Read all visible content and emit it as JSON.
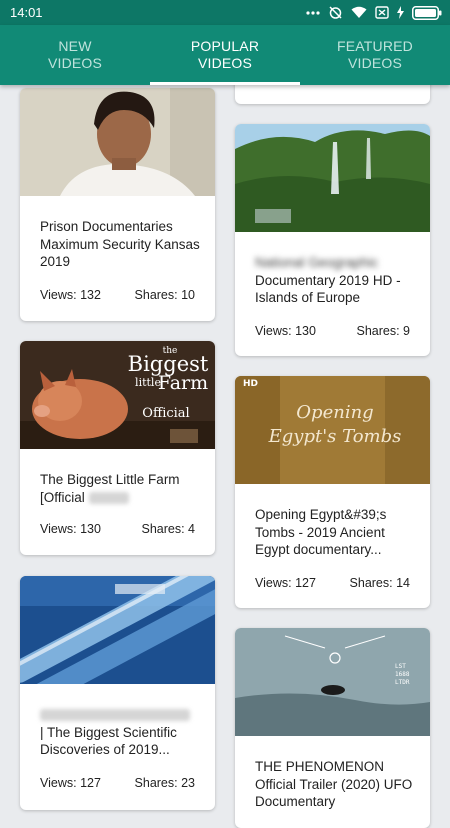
{
  "status": {
    "time": "14:01"
  },
  "tabs": [
    {
      "label": "NEW\nVIDEOS",
      "active": false
    },
    {
      "label": "POPULAR\nVIDEOS",
      "active": true
    },
    {
      "label": "FEATURED\nVIDEOS",
      "active": false
    }
  ],
  "left_cards": [
    {
      "title": "Prison Documentaries Maximum Security Kansas 2019",
      "views": "Views: 132",
      "shares": "Shares: 10"
    },
    {
      "title": "The Biggest Little Farm [Official",
      "views": "Views: 130",
      "shares": "Shares: 4",
      "thumb_text": {
        "line1": "the",
        "line2": "Biggest",
        "line3": "little",
        "line4": "Farm",
        "line5": "Official"
      }
    },
    {
      "title": "| The Biggest Scientific Discoveries of 2019...",
      "views": "Views: 127",
      "shares": "Shares: 23"
    }
  ],
  "right_cards": [
    {
      "title_blur": "National Geographic",
      "title": "Documentary 2019 HD - Islands of Europe",
      "views": "Views: 130",
      "shares": "Shares: 9"
    },
    {
      "title": "Opening Egypt&#39;s Tombs - 2019 Ancient Egypt documentary...",
      "views": "Views: 127",
      "shares": "Shares: 14",
      "thumb_text": {
        "line1": "Opening",
        "line2": "Egypt's Tombs",
        "badge": "HD"
      }
    },
    {
      "title": "THE PHENOMENON Official Trailer (2020) UFO Documentary",
      "thumb_text": {
        "hud1": "LST",
        "hud2": "1688",
        "hud3": "LTDR"
      }
    }
  ]
}
